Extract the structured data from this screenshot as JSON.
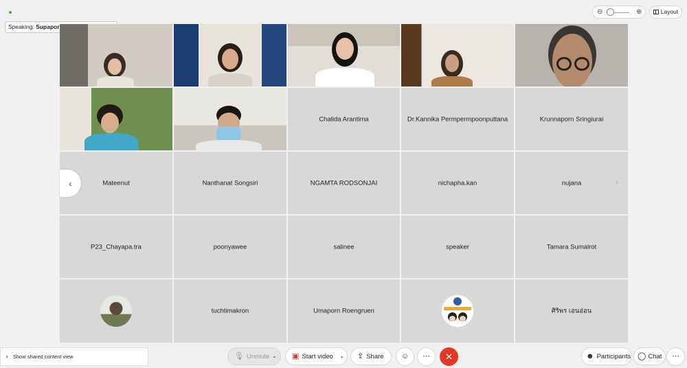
{
  "speaking": {
    "prefix": "Speaking:",
    "name": "Supaporn Timsamran (Host)"
  },
  "toolbar_top": {
    "layout_label": "Layout"
  },
  "participants_grid": [
    "Chalida Arantima",
    "Dr.Kannika Permpermpoonputtana",
    "Krunnaporn Sringiurai",
    "Mateenut",
    "Nanthanat Songsiri",
    "NGAMTA RODSONJAI",
    "nichapha.kan",
    "nujana",
    "P23_Chayapa.tra",
    "poonyawee",
    "salinee",
    "speaker",
    "Tamara Sumalrot",
    "tuchtimakron",
    "Umaporn Roengruen",
    "ศิริพร เอนอ่อน"
  ],
  "bottom": {
    "shared_view": "Show shared content view",
    "unmute": "Unmute",
    "start_video": "Start video",
    "share": "Share",
    "participants": "Participants",
    "chat": "Chat"
  },
  "colors": {
    "leave": "#e2382a",
    "video_off": "#d23b2e",
    "tile_bg": "#d8d8d8",
    "status": "#2bb24c"
  },
  "icons": [
    "zoom-out-icon",
    "zoom-in-icon",
    "layout-icon",
    "chevron-left-icon",
    "chevron-right-icon",
    "mic-off-icon",
    "video-off-icon",
    "share-icon",
    "reactions-icon",
    "more-icon",
    "leave-icon",
    "participants-icon",
    "chat-icon"
  ]
}
